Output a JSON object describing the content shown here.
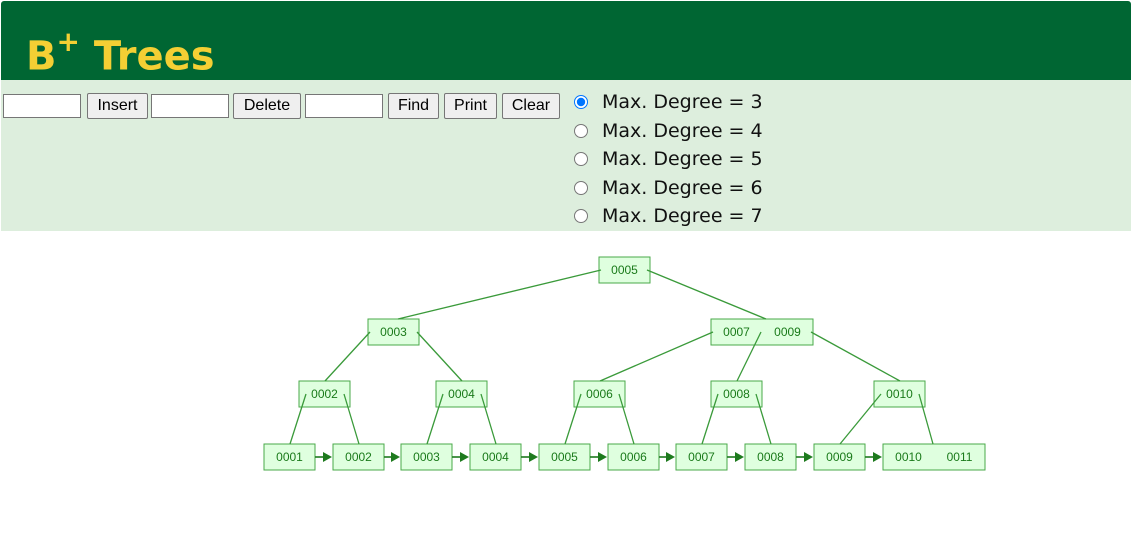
{
  "header": {
    "title": "B",
    "title_sup": "+",
    "title_rest": " Trees"
  },
  "controls": {
    "insert_value": "",
    "insert_label": "Insert",
    "delete_value": "",
    "delete_label": "Delete",
    "find_value": "",
    "find_label": "Find",
    "print_label": "Print",
    "clear_label": "Clear"
  },
  "degree_options": [
    {
      "label": "Max. Degree = 3",
      "selected": true
    },
    {
      "label": "Max. Degree = 4",
      "selected": false
    },
    {
      "label": "Max. Degree = 5",
      "selected": false
    },
    {
      "label": "Max. Degree = 6",
      "selected": false
    },
    {
      "label": "Max. Degree = 7",
      "selected": false
    }
  ],
  "tree": {
    "root": [
      "0005"
    ],
    "level1": [
      [
        "0003"
      ],
      [
        "0007",
        "0009"
      ]
    ],
    "level2": [
      [
        "0002"
      ],
      [
        "0004"
      ],
      [
        "0006"
      ],
      [
        "0008"
      ],
      [
        "0010"
      ]
    ],
    "leaves": [
      [
        "0001"
      ],
      [
        "0002"
      ],
      [
        "0003"
      ],
      [
        "0004"
      ],
      [
        "0005"
      ],
      [
        "0006"
      ],
      [
        "0007"
      ],
      [
        "0008"
      ],
      [
        "0009"
      ],
      [
        "0010",
        "0011"
      ]
    ]
  },
  "colors": {
    "header": "#006633",
    "title": "#f4cf34",
    "panel": "#ddeedd",
    "node_fill": "#dfffdf",
    "node_stroke": "#4aa84a",
    "edge": "#3a9a3a"
  }
}
